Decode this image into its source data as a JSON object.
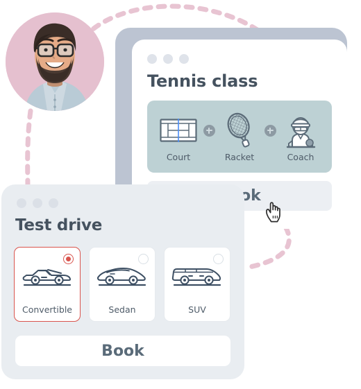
{
  "scene": {
    "background_color": "#ffffff",
    "connector_color": "#e8c4d2"
  },
  "avatar": {
    "name": "user-avatar",
    "alt": "Smiling bearded man with glasses",
    "background_color": "#e5c0cf"
  },
  "tennis_card": {
    "title": "Tennis class",
    "backdrop_color": "#bcc4d2",
    "panel_color": "#bdd1d4",
    "window_dots": [
      "dot-1",
      "dot-2",
      "dot-3"
    ],
    "items": [
      {
        "icon": "tennis-court-icon",
        "label": "Court"
      },
      {
        "icon": "tennis-racket-icon",
        "label": "Racket"
      },
      {
        "icon": "tennis-coach-icon",
        "label": "Coach"
      }
    ],
    "separators": [
      "plus-icon",
      "plus-icon"
    ],
    "book_label": "Book",
    "book_bg": "#eceff3",
    "cursor": "hand-pointer-cursor"
  },
  "test_drive_card": {
    "title": "Test drive",
    "backdrop_color": "#e9edf1",
    "window_dots": [
      "dot-1",
      "dot-2",
      "dot-3"
    ],
    "selected_color": "#d9544d",
    "options": [
      {
        "icon": "convertible-car-icon",
        "label": "Convertible",
        "selected": true
      },
      {
        "icon": "sedan-car-icon",
        "label": "Sedan",
        "selected": false
      },
      {
        "icon": "suv-car-icon",
        "label": "SUV",
        "selected": false
      }
    ],
    "book_label": "Book",
    "book_bg": "#ffffff"
  }
}
